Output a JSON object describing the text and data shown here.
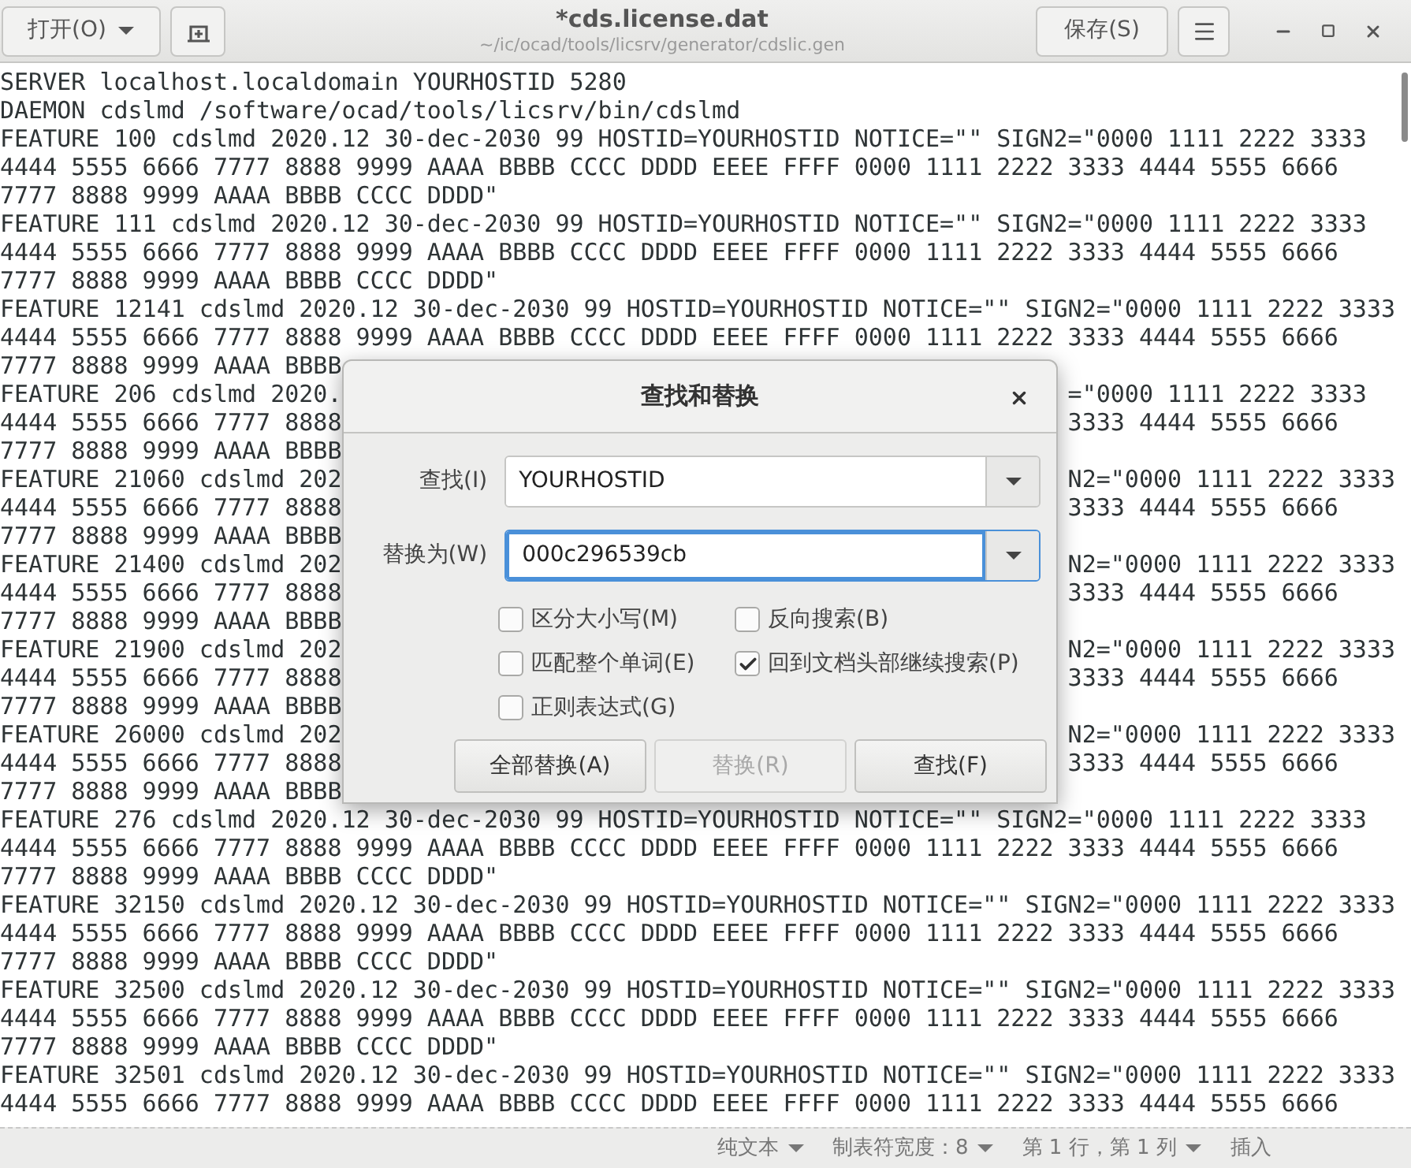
{
  "header": {
    "open_button": "打开(O)",
    "title": "*cds.license.dat",
    "subtitle": "~/ic/ocad/tools/licsrv/generator/cdslic.gen",
    "save_button": "保存(S)"
  },
  "editor": {
    "lines": [
      {
        "text": "SERVER localhost.localdomain YOURHOSTID 5280"
      },
      {
        "text": "DAEMON cdslmd /software/ocad/tools/licsrv/bin/cdslmd"
      },
      {
        "text": "FEATURE 100 cdslmd 2020.12 30-dec-2030 99 HOSTID=YOURHOSTID NOTICE=\"\" SIGN2=\"0000 1111 2222 3333"
      },
      {
        "text": "4444 5555 6666 7777 8888 9999 AAAA BBBB CCCC DDDD EEEE FFFF 0000 1111 2222 3333 4444 5555 6666"
      },
      {
        "text": "7777 8888 9999 AAAA BBBB CCCC DDDD\""
      },
      {
        "text": "FEATURE 111 cdslmd 2020.12 30-dec-2030 99 HOSTID=YOURHOSTID NOTICE=\"\" SIGN2=\"0000 1111 2222 3333"
      },
      {
        "text": "4444 5555 6666 7777 8888 9999 AAAA BBBB CCCC DDDD EEEE FFFF 0000 1111 2222 3333 4444 5555 6666"
      },
      {
        "text": "7777 8888 9999 AAAA BBBB CCCC DDDD\""
      },
      {
        "text": "FEATURE 12141 cdslmd 2020.12 30-dec-2030 99 HOSTID=YOURHOSTID NOTICE=\"\" SIGN2=\"0000 1111 2222 3333"
      },
      {
        "text": "4444 5555 6666 7777 8888 9999 AAAA BBBB CCCC DDDD EEEE FFFF 0000 1111 2222 3333 4444 5555 6666"
      },
      {
        "left": "7777 8888 9999 AAAA BBBB"
      },
      {
        "left": "FEATURE 206 cdslmd 2020.",
        "right": "=\"0000 1111 2222 3333"
      },
      {
        "left": "4444 5555 6666 7777 8888",
        "right": "3333 4444 5555 6666"
      },
      {
        "left": "7777 8888 9999 AAAA BBBB"
      },
      {
        "left": "FEATURE 21060 cdslmd 202",
        "right": "N2=\"0000 1111 2222 3333"
      },
      {
        "left": "4444 5555 6666 7777 8888",
        "right": "3333 4444 5555 6666"
      },
      {
        "left": "7777 8888 9999 AAAA BBBB"
      },
      {
        "left": "FEATURE 21400 cdslmd 202",
        "right": "N2=\"0000 1111 2222 3333"
      },
      {
        "left": "4444 5555 6666 7777 8888",
        "right": "3333 4444 5555 6666"
      },
      {
        "left": "7777 8888 9999 AAAA BBBB"
      },
      {
        "left": "FEATURE 21900 cdslmd 202",
        "right": "N2=\"0000 1111 2222 3333"
      },
      {
        "left": "4444 5555 6666 7777 8888",
        "right": "3333 4444 5555 6666"
      },
      {
        "left": "7777 8888 9999 AAAA BBBB"
      },
      {
        "left": "FEATURE 26000 cdslmd 202",
        "right": "N2=\"0000 1111 2222 3333"
      },
      {
        "left": "4444 5555 6666 7777 8888",
        "right": "3333 4444 5555 6666"
      },
      {
        "left": "7777 8888 9999 AAAA BBBB"
      },
      {
        "text": "FEATURE 276 cdslmd 2020.12 30-dec-2030 99 HOSTID=YOURHOSTID NOTICE=\"\" SIGN2=\"0000 1111 2222 3333"
      },
      {
        "text": "4444 5555 6666 7777 8888 9999 AAAA BBBB CCCC DDDD EEEE FFFF 0000 1111 2222 3333 4444 5555 6666"
      },
      {
        "text": "7777 8888 9999 AAAA BBBB CCCC DDDD\""
      },
      {
        "text": "FEATURE 32150 cdslmd 2020.12 30-dec-2030 99 HOSTID=YOURHOSTID NOTICE=\"\" SIGN2=\"0000 1111 2222 3333"
      },
      {
        "text": "4444 5555 6666 7777 8888 9999 AAAA BBBB CCCC DDDD EEEE FFFF 0000 1111 2222 3333 4444 5555 6666"
      },
      {
        "text": "7777 8888 9999 AAAA BBBB CCCC DDDD\""
      },
      {
        "text": "FEATURE 32500 cdslmd 2020.12 30-dec-2030 99 HOSTID=YOURHOSTID NOTICE=\"\" SIGN2=\"0000 1111 2222 3333"
      },
      {
        "text": "4444 5555 6666 7777 8888 9999 AAAA BBBB CCCC DDDD EEEE FFFF 0000 1111 2222 3333 4444 5555 6666"
      },
      {
        "text": "7777 8888 9999 AAAA BBBB CCCC DDDD\""
      },
      {
        "text": "FEATURE 32501 cdslmd 2020.12 30-dec-2030 99 HOSTID=YOURHOSTID NOTICE=\"\" SIGN2=\"0000 1111 2222 3333"
      },
      {
        "text": "4444 5555 6666 7777 8888 9999 AAAA BBBB CCCC DDDD EEEE FFFF 0000 1111 2222 3333 4444 5555 6666"
      }
    ]
  },
  "dialog": {
    "title": "查找和替换",
    "fields": [
      {
        "label": "查找(I)",
        "value": "YOURHOSTID",
        "focused": false
      },
      {
        "label": "替换为(W)",
        "value": "000c296539cb",
        "focused": true
      }
    ],
    "options": [
      {
        "label": "区分大小写(M)",
        "checked": false
      },
      {
        "label": "反向搜索(B)",
        "checked": false
      },
      {
        "label": "匹配整个单词(E)",
        "checked": false
      },
      {
        "label": "回到文档头部继续搜索(P)",
        "checked": true
      },
      {
        "label": "正则表达式(G)",
        "checked": false
      }
    ],
    "buttons": [
      {
        "label": "全部替换(A)",
        "disabled": false
      },
      {
        "label": "替换(R)",
        "disabled": true
      },
      {
        "label": "查找(F)",
        "disabled": false
      }
    ]
  },
  "status_bar": {
    "items": [
      {
        "label": "纯文本",
        "dropdown": true
      },
      {
        "label": "制表符宽度：8",
        "dropdown": true
      },
      {
        "label": "第 1 行，第 1 列",
        "dropdown": true
      },
      {
        "label": "插入",
        "dropdown": false
      }
    ]
  }
}
